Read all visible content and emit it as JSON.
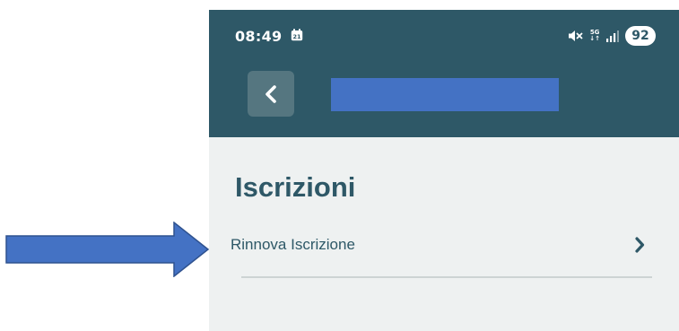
{
  "status_bar": {
    "time": "08:49",
    "calendar_day": "21",
    "network_label_top": "5G",
    "network_label_bottom": "↓↑",
    "battery_level": "92",
    "icons": [
      "calendar-icon",
      "mute-icon",
      "signal-icon"
    ]
  },
  "header": {
    "back_icon": "chevron-left-icon"
  },
  "page": {
    "title": "Iscrizioni"
  },
  "list": {
    "items": [
      {
        "label": "Rinnova Iscrizione",
        "icon": "chevron-right-icon"
      }
    ]
  },
  "annotation": {
    "arrow_color": "#4472c4",
    "arrow_border_color": "#2f528f"
  },
  "colors": {
    "header_bg": "#2e5867",
    "back_button_bg": "#557680",
    "redaction": "#4472c4",
    "page_bg": "#eef1f1",
    "text_primary": "#2e5867",
    "divider": "#cdd3d3"
  }
}
